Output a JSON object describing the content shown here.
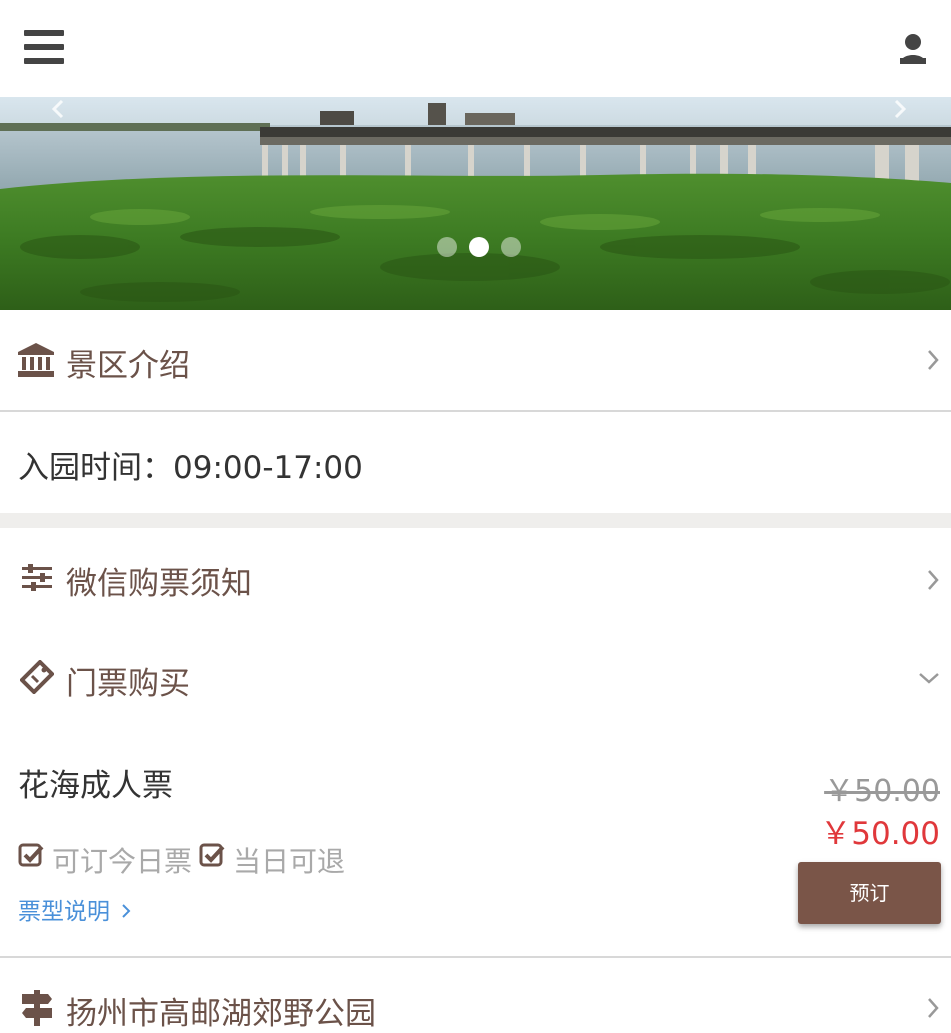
{
  "header": {
    "menu_icon": "menu-icon",
    "user_icon": "user-icon"
  },
  "carousel": {
    "slide_count": 3,
    "active_index": 1,
    "prev_icon": "chevron-left-icon",
    "next_icon": "chevron-right-icon"
  },
  "sections": {
    "intro": {
      "label": "景区介绍",
      "icon": "museum-icon"
    },
    "hours": {
      "text": "入园时间：09:00-17:00"
    },
    "notice": {
      "label": "微信购票须知",
      "icon": "sliders-icon"
    },
    "tickets": {
      "label": "门票购买",
      "icon": "ticket-icon"
    },
    "park": {
      "label": "扬州市高邮湖郊野公园",
      "icon": "signpost-icon"
    }
  },
  "ticket": {
    "name": "花海成人票",
    "original_price": "￥50.00",
    "price": "￥50.00",
    "tags": [
      "可订今日票",
      "当日可退"
    ],
    "type_link": "票型说明",
    "book_label": "预订"
  },
  "colors": {
    "brand_brown": "#7a5548",
    "label_brown": "#6b5249",
    "price_red": "#e0383b",
    "link_blue": "#4a90d9"
  }
}
